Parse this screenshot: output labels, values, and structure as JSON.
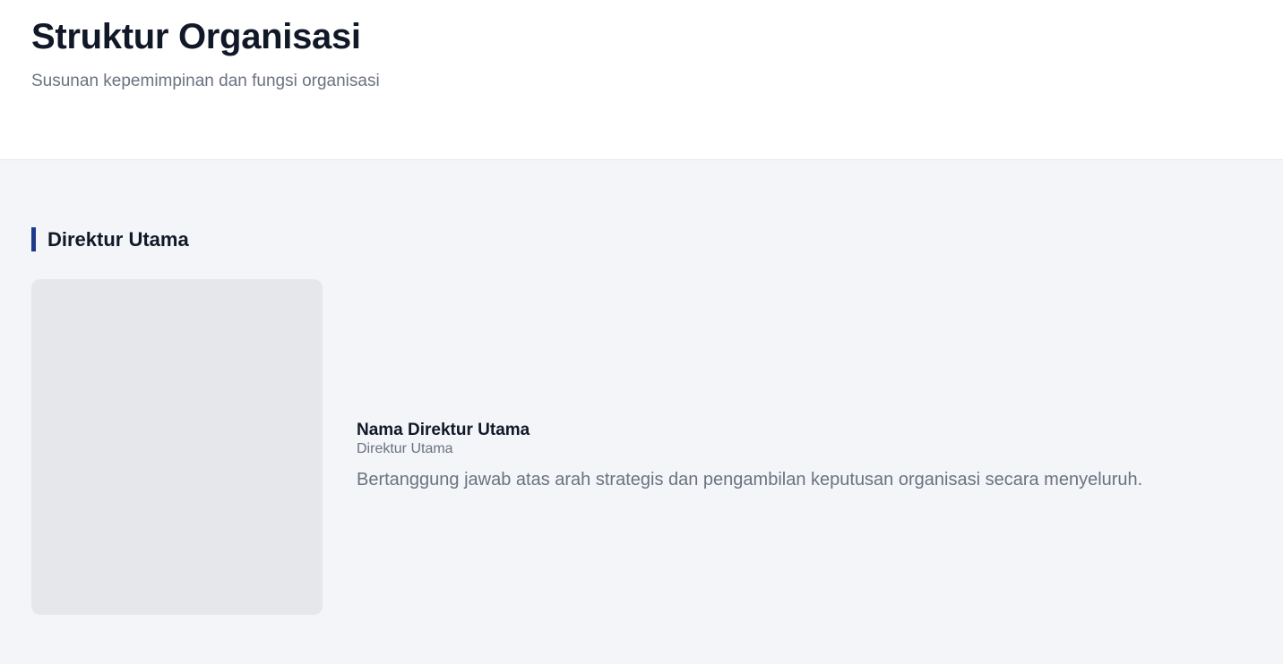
{
  "header": {
    "title": "Struktur Organisasi",
    "subtitle": "Susunan kepemimpinan dan fungsi organisasi"
  },
  "section": {
    "title": "Direktur Utama",
    "accent_color": "#1e3a8a"
  },
  "profile": {
    "name": "Nama Direktur Utama",
    "role": "Direktur Utama",
    "description": "Bertanggung jawab atas arah strategis dan pengambilan keputusan organisasi secara menyeluruh."
  }
}
